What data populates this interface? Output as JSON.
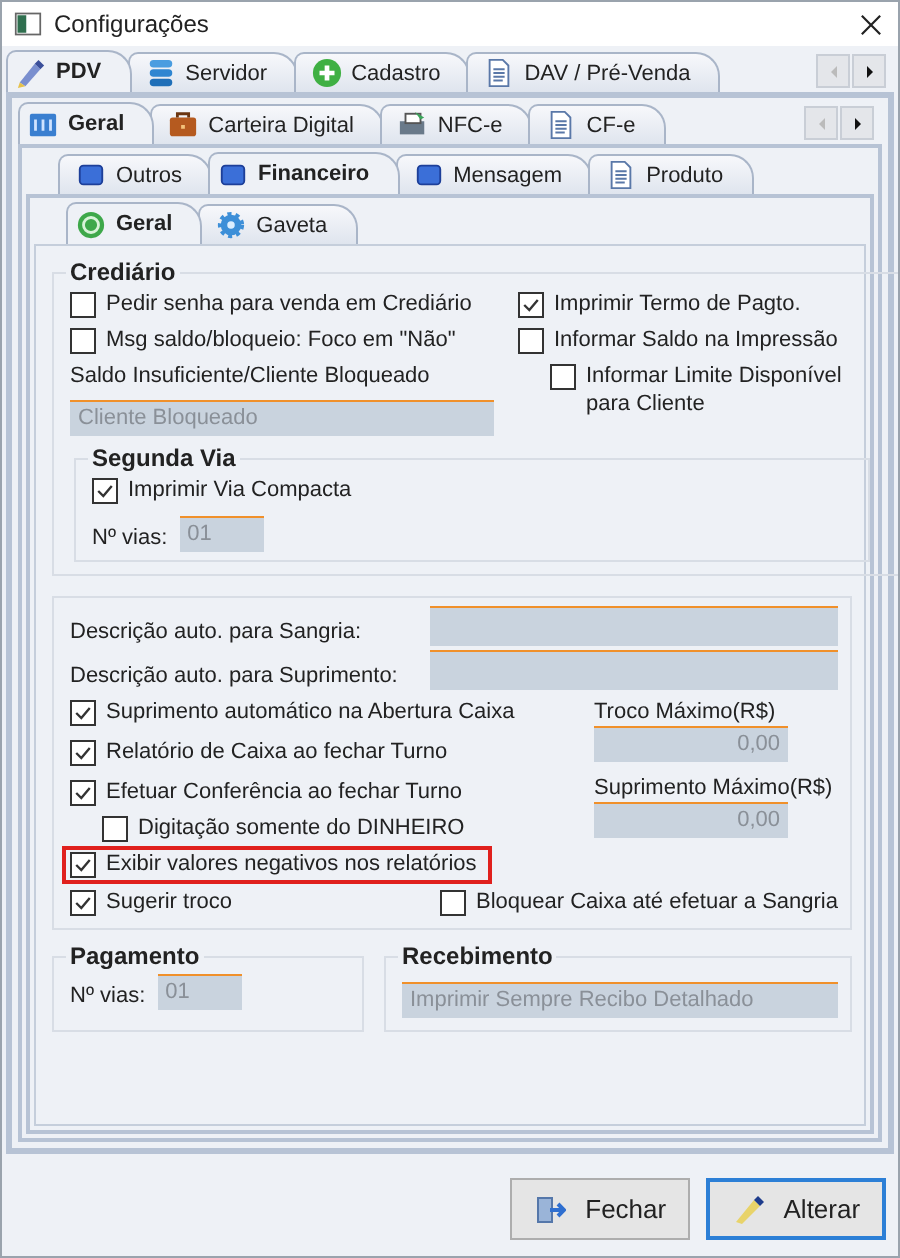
{
  "window": {
    "title": "Configurações"
  },
  "tabs": [
    {
      "label": "PDV",
      "selected": true
    },
    {
      "label": "Servidor",
      "selected": false
    },
    {
      "label": "Cadastro",
      "selected": false
    },
    {
      "label": "DAV / Pré-Venda",
      "selected": false
    }
  ],
  "subtabs": [
    {
      "label": "Geral",
      "selected": true
    },
    {
      "label": "Carteira Digital",
      "selected": false
    },
    {
      "label": "NFC-e",
      "selected": false
    },
    {
      "label": "CF-e",
      "selected": false
    }
  ],
  "section_tabs": [
    {
      "label": "Outros",
      "selected": false
    },
    {
      "label": "Financeiro",
      "selected": true
    },
    {
      "label": "Mensagem",
      "selected": false
    },
    {
      "label": "Produto",
      "selected": false
    }
  ],
  "page_tabs": [
    {
      "label": "Geral",
      "selected": true
    },
    {
      "label": "Gaveta",
      "selected": false
    }
  ],
  "crediario": {
    "title": "Crediário",
    "options_left": [
      {
        "label": "Pedir senha para venda em Crediário",
        "checked": false
      },
      {
        "label": "Msg saldo/bloqueio: Foco em \"Não\"",
        "checked": false
      }
    ],
    "options_right": [
      {
        "label": "Imprimir Termo de Pagto.",
        "checked": true
      },
      {
        "label": "Informar Saldo na Impressão",
        "checked": false,
        "children": [
          {
            "label": "Informar Limite Disponível para Cliente",
            "checked": false
          }
        ]
      }
    ],
    "field_label": "Saldo Insuficiente/Cliente Bloqueado",
    "field_value": "Cliente Bloqueado",
    "segunda_via": {
      "title": "Segunda Via",
      "options": [
        {
          "label": "Imprimir Via Compacta",
          "checked": true
        }
      ],
      "vias_label": "Nº vias:",
      "vias_value": "01"
    }
  },
  "caixa": {
    "description_fields": [
      {
        "label": "Descrição auto. para Sangria:"
      },
      {
        "label": "Descrição auto. para Suprimento:"
      }
    ],
    "options": [
      {
        "label": "Suprimento automático na Abertura Caixa",
        "checked": true,
        "highlighted": false
      },
      {
        "label": "Relatório de Caixa ao fechar Turno",
        "checked": true,
        "highlighted": false
      },
      {
        "label": "Efetuar Conferência ao fechar Turno",
        "checked": true,
        "highlighted": false,
        "children": [
          {
            "label": "Digitação somente do DINHEIRO",
            "checked": false
          }
        ]
      },
      {
        "label": "Exibir valores negativos nos relatórios",
        "checked": true,
        "highlighted": true
      }
    ],
    "limits": [
      {
        "label": "Troco Máximo(R$)",
        "value": "0,00"
      },
      {
        "label": "Suprimento Máximo(R$)",
        "value": "0,00"
      }
    ],
    "bottom_options": [
      {
        "label": "Sugerir troco",
        "checked": true
      },
      {
        "label": "Bloquear Caixa até efetuar a Sangria",
        "checked": false
      }
    ]
  },
  "pagamento": {
    "title": "Pagamento",
    "vias_label": "Nº vias:",
    "vias_value": "01"
  },
  "recebimento": {
    "title": "Recebimento",
    "value": "Imprimir Sempre Recibo Detalhado"
  },
  "buttons": [
    {
      "label": "Fechar",
      "kind": "close",
      "default": false
    },
    {
      "label": "Alterar",
      "kind": "edit",
      "default": true
    }
  ]
}
